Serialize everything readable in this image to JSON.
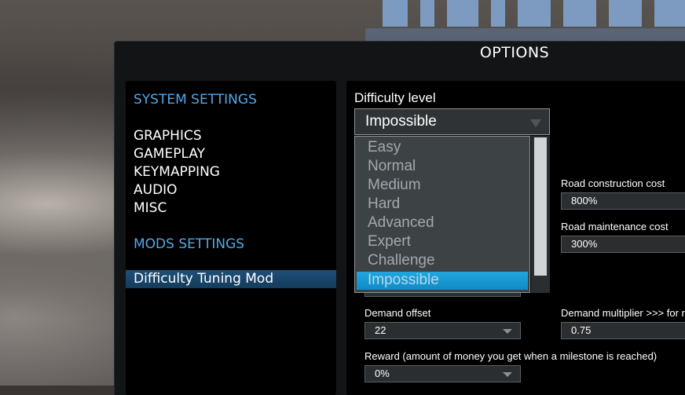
{
  "header": {
    "title": "OPTIONS"
  },
  "sidebar": {
    "system_header": "SYSTEM SETTINGS",
    "items": [
      "GRAPHICS",
      "GAMEPLAY",
      "KEYMAPPING",
      "AUDIO",
      "MISC"
    ],
    "mods_header": "MODS SETTINGS",
    "mods": [
      "Difficulty Tuning Mod"
    ]
  },
  "difficulty": {
    "label": "Difficulty level",
    "selected": "Impossible",
    "options": [
      "Easy",
      "Normal",
      "Medium",
      "Hard",
      "Advanced",
      "Expert",
      "Challenge",
      "Impossible"
    ]
  },
  "settings": {
    "road_construction": {
      "label": "Road construction cost",
      "value": "800%"
    },
    "road_maintenance": {
      "label": "Road maintenance cost",
      "value": "300%"
    },
    "demand_offset": {
      "label": "Demand offset",
      "value": "22"
    },
    "demand_multiplier": {
      "label": "Demand multiplier >>> for r",
      "value": "0.75"
    },
    "reward": {
      "label": "Reward (amount of money you get when a milestone is reached)",
      "value": "0%"
    }
  },
  "colors": {
    "accent": "#54a7e6",
    "selection": "#1ba0da"
  }
}
